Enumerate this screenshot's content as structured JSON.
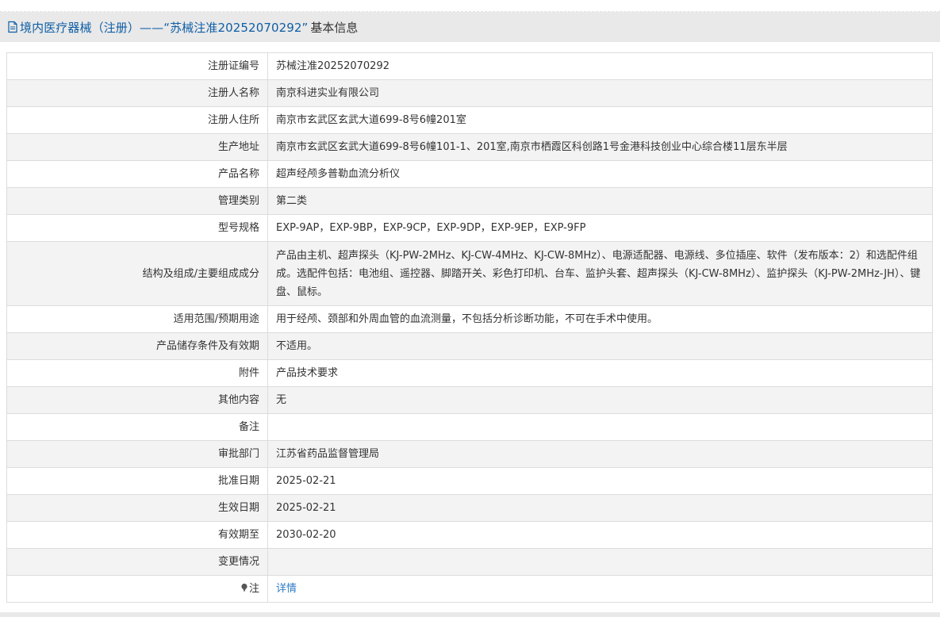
{
  "header": {
    "title_main": "境内医疗器械（注册）——“苏械注准20252070292”",
    "title_suffix": "基本信息"
  },
  "rows": [
    {
      "label": "注册证编号",
      "value": "苏械注准20252070292"
    },
    {
      "label": "注册人名称",
      "value": "南京科进实业有限公司"
    },
    {
      "label": "注册人住所",
      "value": "南京市玄武区玄武大道699-8号6幢201室"
    },
    {
      "label": "生产地址",
      "value": "南京市玄武区玄武大道699-8号6幢101-1、201室,南京市栖霞区科创路1号金港科技创业中心综合楼11层东半层"
    },
    {
      "label": "产品名称",
      "value": "超声经颅多普勒血流分析仪"
    },
    {
      "label": "管理类别",
      "value": "第二类"
    },
    {
      "label": "型号规格",
      "value": "EXP-9AP，EXP-9BP，EXP-9CP，EXP-9DP，EXP-9EP，EXP-9FP"
    },
    {
      "label": "结构及组成/主要组成成分",
      "value": "产品由主机、超声探头（KJ-PW-2MHz、KJ-CW-4MHz、KJ-CW-8MHz）、电源适配器、电源线、多位插座、软件（发布版本：2）和选配件组成。选配件包括：电池组、遥控器、脚踏开关、彩色打印机、台车、监护头套、超声探头（KJ-CW-8MHz）、监护探头（KJ-PW-2MHz-JH）、键盘、鼠标。"
    },
    {
      "label": "适用范围/预期用途",
      "value": "用于经颅、颈部和外周血管的血流测量，不包括分析诊断功能，不可在手术中使用。"
    },
    {
      "label": "产品储存条件及有效期",
      "value": "不适用。"
    },
    {
      "label": "附件",
      "value": "产品技术要求"
    },
    {
      "label": "其他内容",
      "value": "无"
    },
    {
      "label": "备注",
      "value": ""
    },
    {
      "label": "审批部门",
      "value": "江苏省药品监督管理局"
    },
    {
      "label": "批准日期",
      "value": "2025-02-21"
    },
    {
      "label": "生效日期",
      "value": "2025-02-21"
    },
    {
      "label": "有效期至",
      "value": "2030-02-20"
    },
    {
      "label": "变更情况",
      "value": ""
    }
  ],
  "note_row": {
    "label": "注",
    "link": "详情"
  },
  "icons": {
    "title": "document-icon",
    "note": "pin-icon"
  },
  "colors": {
    "title": "#0e5ea6",
    "link": "#2e7bc4",
    "header_bg": "#e9e9e9",
    "stripe": "#f3f3f3"
  }
}
